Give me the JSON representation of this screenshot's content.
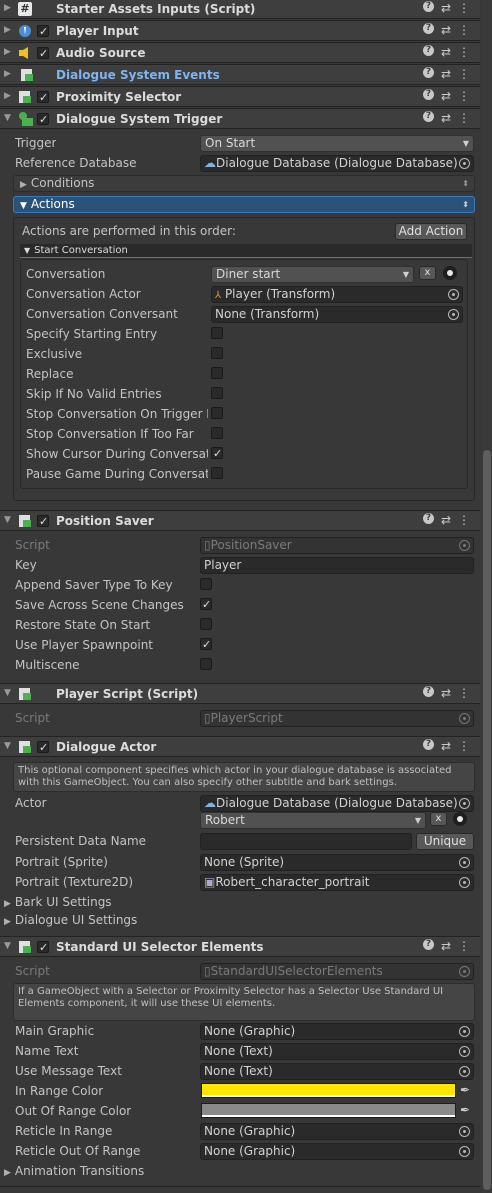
{
  "components": {
    "c1": {
      "title": "Starter Assets Inputs (Script)"
    },
    "c2": {
      "title": "Player Input"
    },
    "c3": {
      "title": "Audio Source"
    },
    "c4": {
      "title": "Dialogue System Events"
    },
    "c5": {
      "title": "Proximity Selector"
    },
    "c6": {
      "title": "Dialogue System Trigger"
    },
    "c7": {
      "title": "Position Saver"
    },
    "c8": {
      "title": "Player Script (Script)"
    },
    "c9": {
      "title": "Dialogue Actor"
    },
    "c10": {
      "title": "Standard UI Selector Elements"
    }
  },
  "trigger": {
    "trigger_label": "Trigger",
    "trigger_value": "On Start",
    "refdb_label": "Reference Database",
    "refdb_value": "Dialogue Database (Dialogue Database)",
    "conditions": "Conditions",
    "actions": "Actions",
    "actions_order": "Actions are performed in this order:",
    "add_action": "Add Action",
    "start_conversation": "Start Conversation",
    "conv_label": "Conversation",
    "conv_value": "Diner start",
    "clear": "x",
    "actor_label": "Conversation Actor",
    "actor_value": "Player (Transform)",
    "conversant_label": "Conversation Conversant",
    "conversant_value": "None (Transform)",
    "specify_entry": "Specify Starting Entry",
    "exclusive": "Exclusive",
    "replace": "Replace",
    "skip_invalid": "Skip If No Valid Entries",
    "stop_on_exit": "Stop Conversation On Trigger Ex",
    "stop_far": "Stop Conversation If Too Far",
    "show_cursor": "Show Cursor During Conversatio",
    "pause_game": "Pause Game During Conversatio"
  },
  "saver": {
    "script_label": "Script",
    "script_value": "PositionSaver",
    "key_label": "Key",
    "key_value": "Player",
    "append": "Append Saver Type To Key",
    "save_across": "Save Across Scene Changes",
    "restore": "Restore State On Start",
    "use_spawn": "Use Player Spawnpoint",
    "multiscene": "Multiscene"
  },
  "player_script": {
    "script_label": "Script",
    "script_value": "PlayerScript"
  },
  "actor": {
    "info": "This optional component specifies which actor in your dialogue database is associated with this GameObject. You can also specify other subtitle and bark settings.",
    "actor_label": "Actor",
    "actor_db": "Dialogue Database (Dialogue Database)",
    "actor_value": "Robert",
    "clear": "x",
    "persistent_label": "Persistent Data Name",
    "persistent_value": "",
    "unique": "Unique",
    "portrait_sprite_label": "Portrait (Sprite)",
    "portrait_sprite_value": "None (Sprite)",
    "portrait_tex_label": "Portrait (Texture2D)",
    "portrait_tex_value": "Robert_character_portrait",
    "bark_ui": "Bark UI Settings",
    "dialogue_ui": "Dialogue UI Settings"
  },
  "selector": {
    "script_label": "Script",
    "script_value": "StandardUISelectorElements",
    "info": "If a GameObject with a Selector or Proximity Selector has a Selector Use Standard UI Elements component, it will use these UI elements.",
    "main_graphic_label": "Main Graphic",
    "main_graphic_value": "None (Graphic)",
    "name_text_label": "Name Text",
    "name_text_value": "None (Text)",
    "use_msg_label": "Use Message Text",
    "use_msg_value": "None (Text)",
    "in_range_label": "In Range Color",
    "in_range_color": "#ffe600",
    "out_range_label": "Out Of Range Color",
    "out_range_color": "#8a8a8a",
    "reticle_in_label": "Reticle In Range",
    "reticle_in_value": "None (Graphic)",
    "reticle_out_label": "Reticle Out Of Range",
    "reticle_out_value": "None (Graphic)",
    "anim": "Animation Transitions"
  },
  "colors": {
    "accent": "#3a79bb",
    "panel": "#383838",
    "header": "#3e3e3e"
  }
}
